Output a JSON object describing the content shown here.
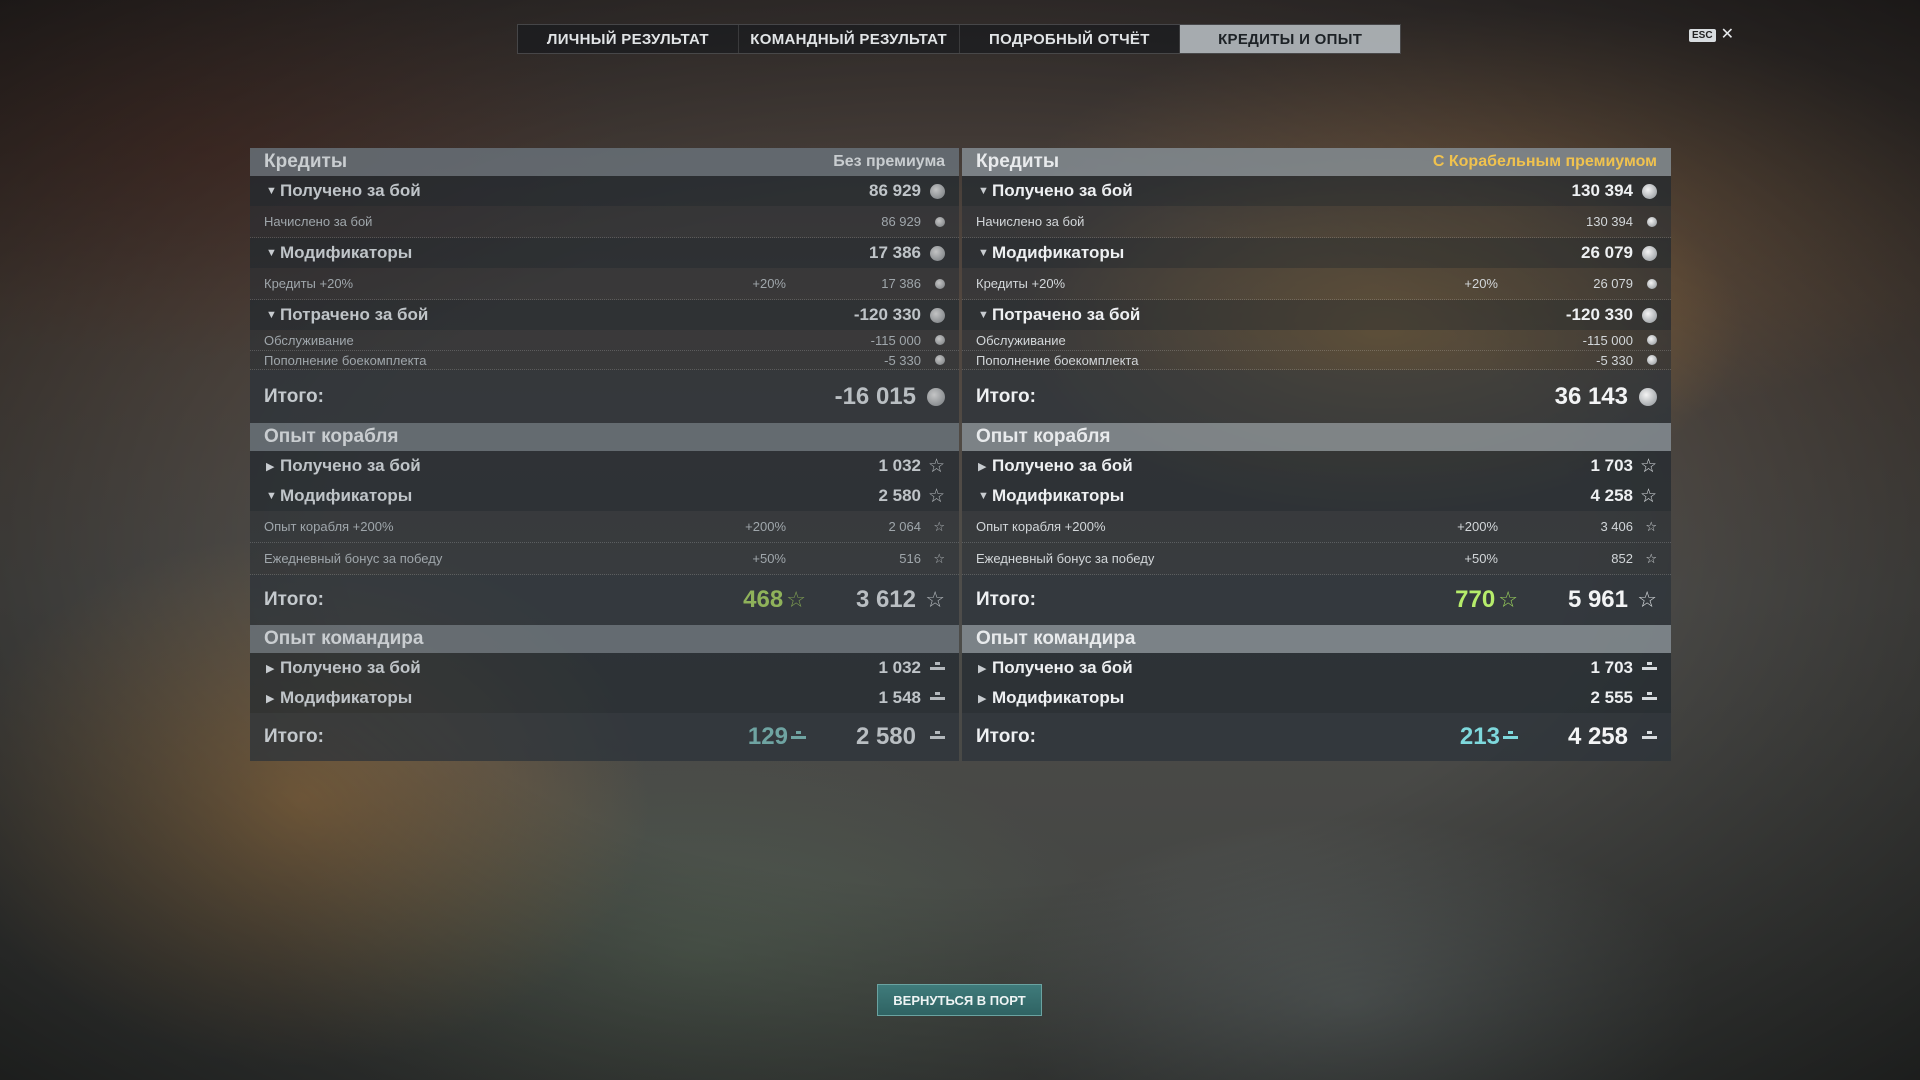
{
  "tabs": [
    {
      "label": "ЛИЧНЫЙ РЕЗУЛЬТАТ",
      "active": false
    },
    {
      "label": "КОМАНДНЫЙ РЕЗУЛЬТАТ",
      "active": false
    },
    {
      "label": "ПОДРОБНЫЙ ОТЧЁТ",
      "active": false
    },
    {
      "label": "КРЕДИТЫ И ОПЫТ",
      "active": true
    }
  ],
  "esc": {
    "key": "ESC",
    "close": "✕"
  },
  "left": {
    "credits": {
      "title": "Кредиты",
      "subtitle": "Без премиума",
      "earned": {
        "label": "Получено за бой",
        "value": "86 929"
      },
      "earned_detail": {
        "label": "Начислено за бой",
        "value": "86 929"
      },
      "modifiers": {
        "label": "Модификаторы",
        "value": "17 386"
      },
      "modifiers_detail": {
        "label": "Кредиты +20%",
        "pct": "+20%",
        "value": "17 386"
      },
      "spent": {
        "label": "Потрачено за бой",
        "value": "-120 330"
      },
      "service": {
        "label": "Обслуживание",
        "value": "-115 000"
      },
      "ammo": {
        "label": "Пополнение боекомплекта",
        "value": "-5 330"
      },
      "total": {
        "label": "Итого:",
        "value": "-16 015"
      }
    },
    "ship_xp": {
      "title": "Опыт корабля",
      "earned": {
        "label": "Получено за бой",
        "value": "1 032"
      },
      "modifiers": {
        "label": "Модификаторы",
        "value": "2 580"
      },
      "mod1": {
        "label": "Опыт корабля +200%",
        "pct": "+200%",
        "value": "2 064"
      },
      "mod2": {
        "label": "Ежедневный бонус за победу",
        "pct": "+50%",
        "value": "516"
      },
      "total": {
        "label": "Итого:",
        "bonus": "468",
        "value": "3 612"
      }
    },
    "cmdr_xp": {
      "title": "Опыт командира",
      "earned": {
        "label": "Получено за бой",
        "value": "1 032"
      },
      "modifiers": {
        "label": "Модификаторы",
        "value": "1 548"
      },
      "total": {
        "label": "Итого:",
        "bonus": "129",
        "value": "2 580"
      }
    }
  },
  "right": {
    "credits": {
      "title": "Кредиты",
      "subtitle": "С Корабельным премиумом",
      "earned": {
        "label": "Получено за бой",
        "value": "130 394"
      },
      "earned_detail": {
        "label": "Начислено за бой",
        "value": "130 394"
      },
      "modifiers": {
        "label": "Модификаторы",
        "value": "26 079"
      },
      "modifiers_detail": {
        "label": "Кредиты +20%",
        "pct": "+20%",
        "value": "26 079"
      },
      "spent": {
        "label": "Потрачено за бой",
        "value": "-120 330"
      },
      "service": {
        "label": "Обслуживание",
        "value": "-115 000"
      },
      "ammo": {
        "label": "Пополнение боекомплекта",
        "value": "-5 330"
      },
      "total": {
        "label": "Итого:",
        "value": "36 143"
      }
    },
    "ship_xp": {
      "title": "Опыт корабля",
      "earned": {
        "label": "Получено за бой",
        "value": "1 703"
      },
      "modifiers": {
        "label": "Модификаторы",
        "value": "4 258"
      },
      "mod1": {
        "label": "Опыт корабля +200%",
        "pct": "+200%",
        "value": "3 406"
      },
      "mod2": {
        "label": "Ежедневный бонус за победу",
        "pct": "+50%",
        "value": "852"
      },
      "total": {
        "label": "Итого:",
        "bonus": "770",
        "value": "5 961"
      }
    },
    "cmdr_xp": {
      "title": "Опыт командира",
      "earned": {
        "label": "Получено за бой",
        "value": "1 703"
      },
      "modifiers": {
        "label": "Модификаторы",
        "value": "2 555"
      },
      "total": {
        "label": "Итого:",
        "bonus": "213",
        "value": "4 258"
      }
    }
  },
  "icons": {
    "credits": "credits-coin-icon",
    "ship_xp": "star-xp-icon",
    "cmdr_xp": "commander-xp-icon",
    "expanded": "triangle-down-icon",
    "collapsed": "triangle-right-icon"
  },
  "colors": {
    "premium_accent": "#f0c24e",
    "bonus_xp": "#b6ec6b",
    "bonus_cmdr_xp": "#7ed8dc",
    "button": "#2f6363"
  },
  "footer": {
    "return_button": "ВЕРНУТЬСЯ В ПОРТ"
  }
}
